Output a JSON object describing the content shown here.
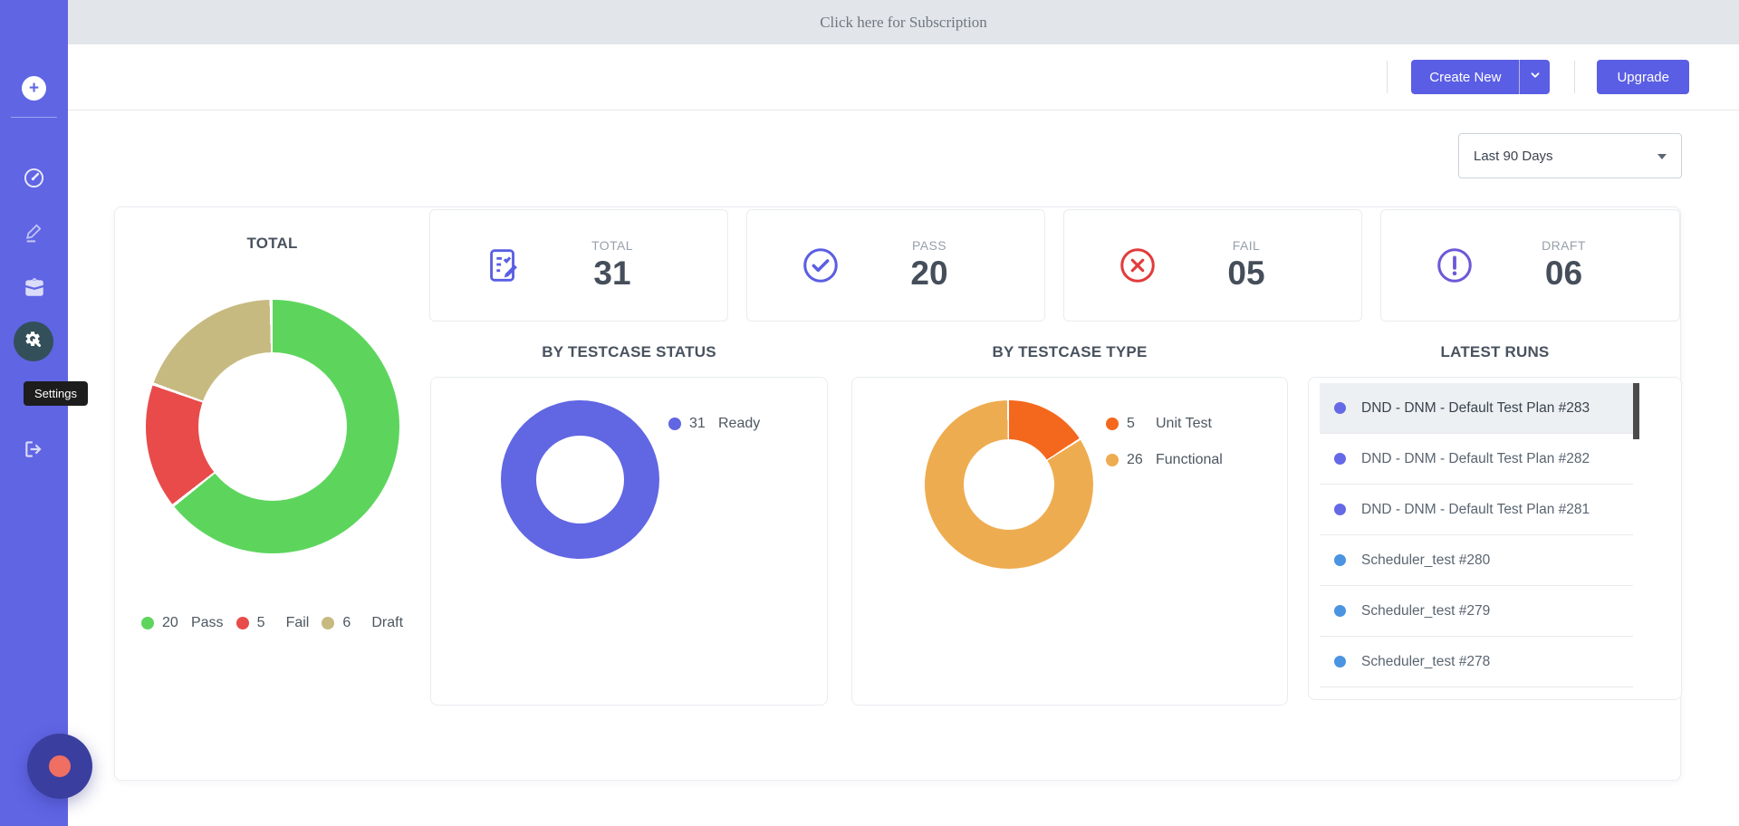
{
  "banner": {
    "text": "Click here for Subscription"
  },
  "header": {
    "create_new": "Create New",
    "upgrade": "Upgrade"
  },
  "filters": {
    "date_range": "Last 90 Days"
  },
  "sidebar": {
    "tooltip": "Settings",
    "icons": [
      "plus",
      "dashboard",
      "edit",
      "briefcase",
      "settings",
      "logout"
    ],
    "active_item": "settings"
  },
  "colors": {
    "sidebar": "#6065e4",
    "accent": "#5a5ee4",
    "banner_bg": "#e2e5e9",
    "settings_active_bg": "#33505a",
    "fab": "#3a3e9f",
    "fab_dot": "#ef6f62",
    "fail_red": "#e23b3b",
    "draft_purple": "#6e58d8"
  },
  "stats": [
    {
      "label": "TOTAL",
      "value": "31",
      "icon": "document-edit-icon"
    },
    {
      "label": "PASS",
      "value": "20",
      "icon": "check-circle-icon"
    },
    {
      "label": "FAIL",
      "value": "05",
      "icon": "x-circle-icon"
    },
    {
      "label": "DRAFT",
      "value": "06",
      "icon": "exclamation-circle-icon"
    }
  ],
  "chart_data": [
    {
      "type": "donut",
      "title": "TOTAL",
      "legend_position": "bottom",
      "series": [
        {
          "label": "Pass",
          "value": 20,
          "color": "#5dd55d"
        },
        {
          "label": "Fail",
          "value": 5,
          "color": "#e94b4b"
        },
        {
          "label": "Draft",
          "value": 6,
          "color": "#c7ba81"
        }
      ]
    },
    {
      "type": "donut",
      "title": "BY TESTCASE STATUS",
      "legend_position": "right",
      "series": [
        {
          "label": "Ready",
          "value": 31,
          "color": "#6166e3"
        }
      ]
    },
    {
      "type": "donut",
      "title": "BY TESTCASE TYPE",
      "legend_position": "right",
      "series": [
        {
          "label": "Unit Test",
          "value": 5,
          "color": "#f4681d"
        },
        {
          "label": "Functional",
          "value": 26,
          "color": "#eeac50"
        }
      ]
    }
  ],
  "latest_runs": {
    "title": "LATEST RUNS",
    "items": [
      {
        "label": "DND - DNM - Default Test Plan #283",
        "dot_color": "#6569e6",
        "active": true
      },
      {
        "label": "DND - DNM - Default Test Plan #282",
        "dot_color": "#6569e6",
        "active": false
      },
      {
        "label": "DND - DNM - Default Test Plan #281",
        "dot_color": "#6569e6",
        "active": false
      },
      {
        "label": "Scheduler_test #280",
        "dot_color": "#4a94e2",
        "active": false
      },
      {
        "label": "Scheduler_test #279",
        "dot_color": "#4a94e2",
        "active": false
      },
      {
        "label": "Scheduler_test #278",
        "dot_color": "#4a94e2",
        "active": false
      }
    ]
  }
}
